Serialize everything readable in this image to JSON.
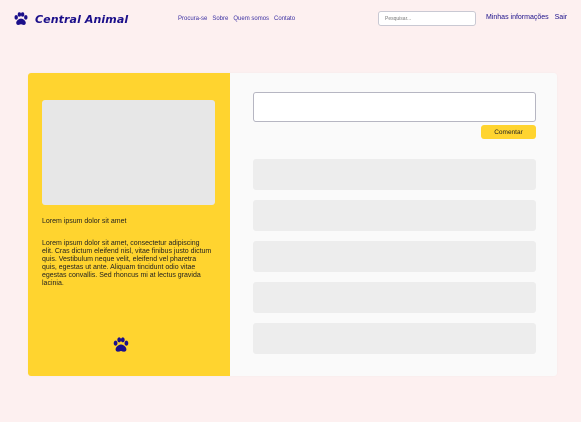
{
  "brand": {
    "name": "Central Animal",
    "icon": "paw-icon",
    "color": "#1b0f8a"
  },
  "nav": {
    "items": [
      "Procura-se",
      "Sobre",
      "Quem somos",
      "Contato"
    ]
  },
  "search": {
    "placeholder": "Pesquisar..."
  },
  "user_links": {
    "profile": "Minhas informações",
    "logout": "Sair"
  },
  "profile": {
    "title": "Lorem ipsum dolor sit amet",
    "description": "Lorem ipsum dolor sit amet, consectetur adipiscing elit. Cras dictum eleifend nisl, vitae finibus justo dictum quis. Vestibulum neque velit, eleifend vel pharetra quis, egestas ut ante. Aliquam tincidunt odio vitae egestas convallis. Sed rhoncus mi at lectus gravida lacinia.",
    "icon": "paw-icon"
  },
  "comment_form": {
    "value": "",
    "button_label": "Comentar"
  },
  "comments": {
    "placeholders": 5
  },
  "colors": {
    "accent": "#ffd42f",
    "background": "#fdf0f0",
    "panel": "#fafafa",
    "placeholder_block": "#ededed"
  }
}
